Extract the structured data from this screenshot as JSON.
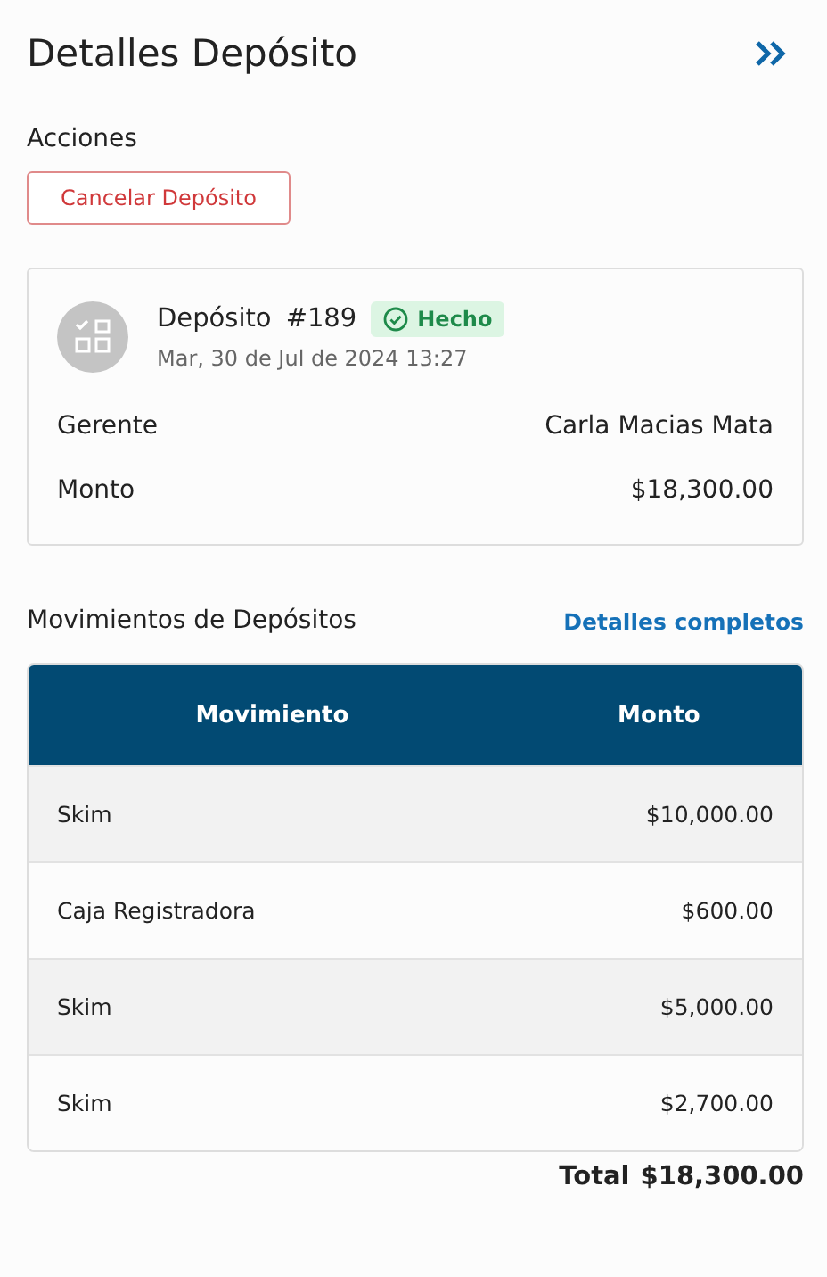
{
  "header": {
    "title": "Detalles Depósito"
  },
  "actions": {
    "label": "Acciones",
    "buttons": [
      "Cancelar Depósito"
    ]
  },
  "deposit": {
    "title": "Depósito",
    "number": "#189",
    "status": {
      "label": "Hecho",
      "kind": "done"
    },
    "date": "Mar, 30 de Jul de 2024 13:27",
    "fields": [
      {
        "label": "Gerente",
        "value": "Carla Macias Mata"
      },
      {
        "label": "Monto",
        "value": "$18,300.00"
      }
    ]
  },
  "movements": {
    "title": "Movimientos de Depósitos",
    "link": "Detalles completos",
    "columns": [
      "Movimiento",
      "Monto"
    ],
    "rows": [
      {
        "movement": "Skim",
        "amount": "$10,000.00"
      },
      {
        "movement": "Caja Registradora",
        "amount": "$600.00"
      },
      {
        "movement": "Skim",
        "amount": "$5,000.00"
      },
      {
        "movement": "Skim",
        "amount": "$2,700.00"
      }
    ],
    "total_label": "Total",
    "total": "$18,300.00"
  }
}
